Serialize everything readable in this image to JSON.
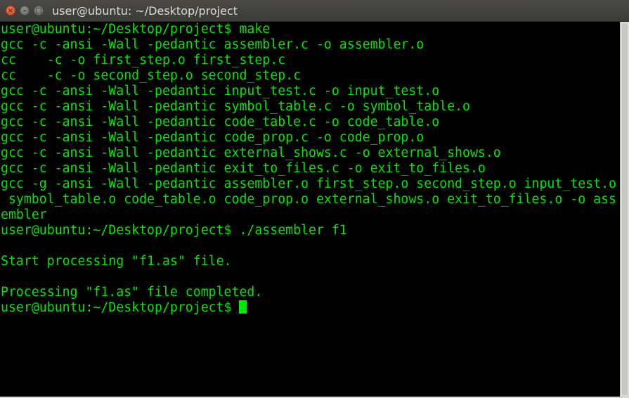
{
  "window": {
    "title": "user@ubuntu: ~/Desktop/project",
    "close_glyph": "×",
    "minimize_glyph": "–",
    "maximize_glyph": "□",
    "close_icon": "close-icon",
    "minimize_icon": "minimize-icon",
    "maximize_icon": "maximize-icon"
  },
  "colors": {
    "background": "#000000",
    "text": "#00e800",
    "titlebar": "#3c3b37",
    "close_button": "#df4a16"
  },
  "terminal": {
    "lines": [
      "user@ubuntu:~/Desktop/project$ make",
      "gcc -c -ansi -Wall -pedantic assembler.c -o assembler.o",
      "cc    -c -o first_step.o first_step.c",
      "cc    -c -o second_step.o second_step.c",
      "gcc -c -ansi -Wall -pedantic input_test.c -o input_test.o",
      "gcc -c -ansi -Wall -pedantic symbol_table.c -o symbol_table.o",
      "gcc -c -ansi -Wall -pedantic code_table.c -o code_table.o",
      "gcc -c -ansi -Wall -pedantic code_prop.c -o code_prop.o",
      "gcc -c -ansi -Wall -pedantic external_shows.c -o external_shows.o",
      "gcc -c -ansi -Wall -pedantic exit_to_files.c -o exit_to_files.o",
      "gcc -g -ansi -Wall -pedantic assembler.o first_step.o second_step.o input_test.o",
      " symbol_table.o code_table.o code_prop.o external_shows.o exit_to_files.o -o ass",
      "embler",
      "user@ubuntu:~/Desktop/project$ ./assembler f1",
      "",
      "Start processing \"f1.as\" file.",
      "",
      "Processing \"f1.as\" file completed."
    ],
    "current_prompt": "user@ubuntu:~/Desktop/project$ "
  }
}
